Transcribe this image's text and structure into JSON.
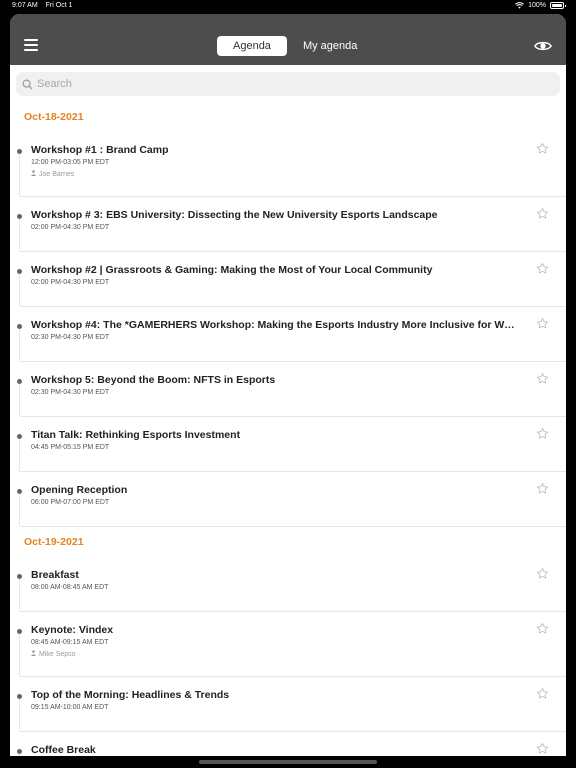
{
  "status_bar": {
    "time": "9:07 AM",
    "date": "Fri Oct 1",
    "battery": "100%"
  },
  "header": {
    "tabs": [
      {
        "label": "Agenda",
        "active": true
      },
      {
        "label": "My agenda",
        "active": false
      }
    ]
  },
  "search": {
    "placeholder": "Search"
  },
  "days": [
    {
      "date": "Oct-18-2021",
      "sessions": [
        {
          "title": "Workshop #1 : Brand Camp",
          "time": "12:00 PM-03:05 PM EDT",
          "speaker": "Joe Barnes"
        },
        {
          "title": "Workshop # 3: EBS University: Dissecting the New University Esports Landscape",
          "time": "02:00 PM-04:30 PM EDT"
        },
        {
          "title": "Workshop #2 | Grassroots & Gaming: Making the Most of Your Local Community",
          "time": "02:00 PM-04:30 PM EDT"
        },
        {
          "title": "Workshop #4: The *GAMERHERS Workshop: Making the Esports Industry More Inclusive for Wo...",
          "time": "02:30 PM-04:30 PM EDT"
        },
        {
          "title": "Workshop 5: Beyond the Boom: NFTS in Esports",
          "time": "02:30 PM-04:30 PM EDT"
        },
        {
          "title": "Titan Talk: Rethinking Esports Investment",
          "time": "04:45 PM-05:15 PM EDT"
        },
        {
          "title": "Opening Reception",
          "time": "06:00 PM-07:00 PM EDT"
        }
      ]
    },
    {
      "date": "Oct-19-2021",
      "sessions": [
        {
          "title": "Breakfast",
          "time": "08:00 AM-08:45 AM EDT"
        },
        {
          "title": "Keynote: Vindex",
          "time": "08:45 AM-09:15 AM EDT",
          "speaker": "Mike Sepso"
        },
        {
          "title": "Top of the Morning: Headlines & Trends",
          "time": "09:15 AM-10:00 AM EDT"
        },
        {
          "title": "Coffee Break",
          "time": ""
        }
      ]
    }
  ],
  "colors": {
    "header_bg": "#4d4d4d",
    "date_accent": "#e8811f"
  },
  "icons": {
    "menu": "hamburger-icon",
    "visibility": "eye-icon",
    "search": "search-icon",
    "favorite": "star-outline-icon",
    "speaker": "person-icon"
  }
}
